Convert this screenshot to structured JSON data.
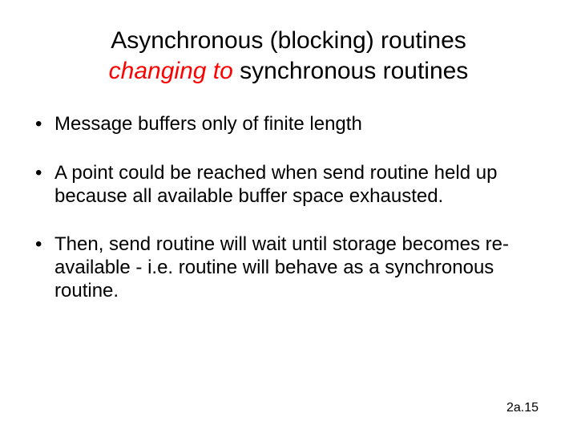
{
  "title": {
    "line1": "Asynchronous (blocking) routines",
    "line2_emph": "changing to",
    "line2_rest": " synchronous routines"
  },
  "bullets": [
    "Message buffers only of finite length",
    "A point could be reached when send routine held up because all available buffer space exhausted.",
    "Then, send routine will wait until storage becomes re-available - i.e. routine will behave as a synchronous routine."
  ],
  "footer": "2a.15"
}
